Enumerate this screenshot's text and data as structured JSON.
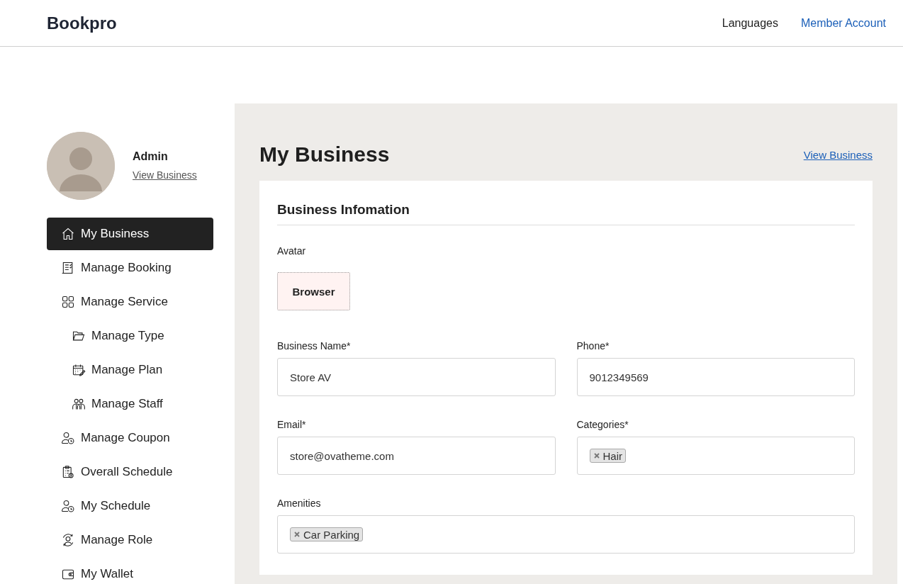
{
  "header": {
    "brand": "Bookpro",
    "links": [
      {
        "label": "Languages",
        "kind": "plain"
      },
      {
        "label": "Member Account",
        "kind": "accent"
      }
    ]
  },
  "profile": {
    "name": "Admin",
    "link": "View Business"
  },
  "sidebar": {
    "items": [
      {
        "label": "My Business",
        "selected": true
      },
      {
        "label": "Manage Booking",
        "selected": false
      },
      {
        "label": "Manage Service",
        "selected": false,
        "children": [
          {
            "label": "Manage Type",
            "selected": false
          },
          {
            "label": "Manage Plan",
            "selected": false
          },
          {
            "label": "Manage Staff",
            "selected": false
          }
        ]
      },
      {
        "label": "Manage Coupon",
        "selected": false
      },
      {
        "label": "Overall Schedule",
        "selected": false
      },
      {
        "label": "My Schedule",
        "selected": false
      },
      {
        "label": "Manage Role",
        "selected": false
      },
      {
        "label": "My Wallet",
        "selected": false
      }
    ]
  },
  "main": {
    "title": "My Business",
    "link": "View Business",
    "card": {
      "title": "Business Infomation",
      "avatar_label": "Avatar",
      "upload_button": "Browser",
      "fields": [
        {
          "label": "Business Name*",
          "kind": "text",
          "value": "Store AV"
        },
        {
          "label": "Phone*",
          "kind": "text",
          "value": "9012349569"
        },
        {
          "label": "Email*",
          "kind": "text",
          "value": "store@ovatheme.com"
        },
        {
          "label": "Categories*",
          "kind": "tags",
          "tags": [
            "Hair"
          ]
        },
        {
          "label": "Amenities",
          "kind": "tags",
          "tags": [
            "Car Parking"
          ]
        }
      ]
    }
  }
}
